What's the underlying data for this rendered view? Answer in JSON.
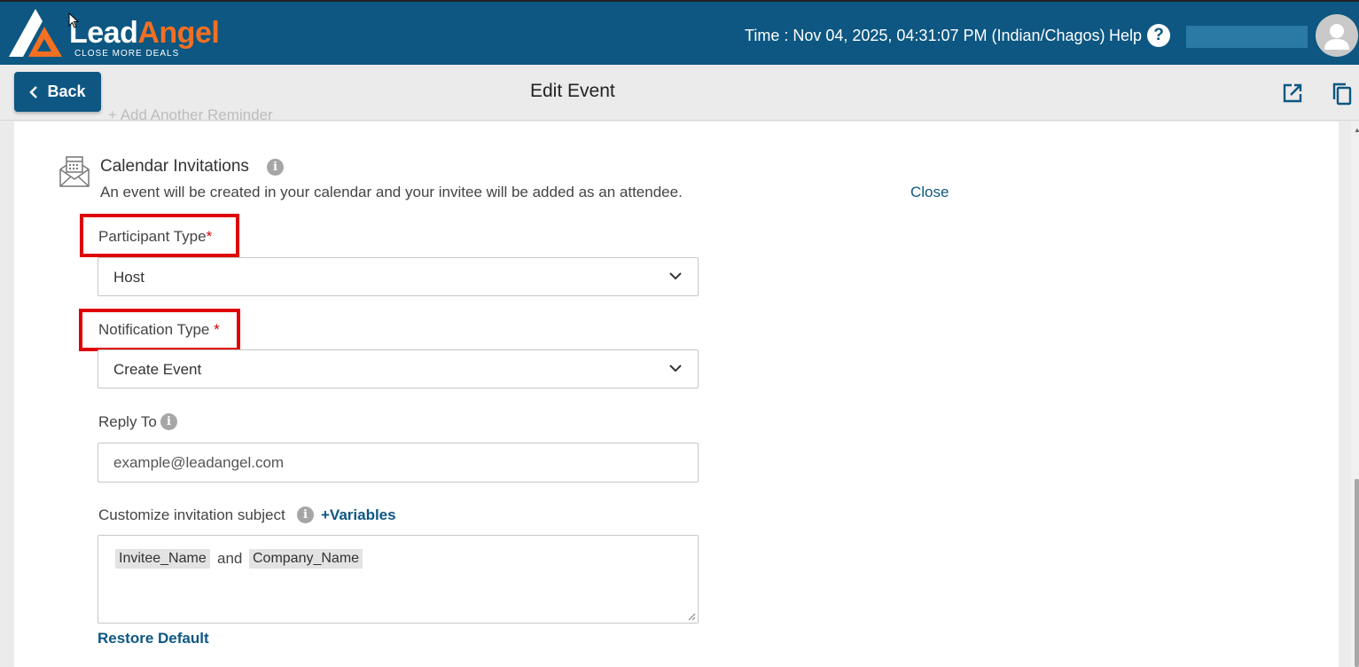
{
  "header": {
    "brand_lead": "Lead",
    "brand_angel": "Angel",
    "brand_tagline": "CLOSE MORE DEALS",
    "time": "Time : Nov 04, 2025, 04:31:07 PM (Indian/Chagos)",
    "help_label": "Help",
    "help_icon_glyph": "?"
  },
  "toolbar": {
    "back_label": "Back",
    "page_title": "Edit Event"
  },
  "section": {
    "cut_off_text": "+ Add Another Reminder",
    "title": "Calendar Invitations",
    "description": "An event will be created in your calendar and your invitee will be added as an attendee.",
    "close_label": "Close",
    "info_glyph": "i"
  },
  "form": {
    "participant_type": {
      "label": "Participant Type",
      "required_mark": "*",
      "value": "Host"
    },
    "notification_type": {
      "label": "Notification Type",
      "required_mark": "*",
      "value": "Create Event"
    },
    "reply_to": {
      "label": "Reply To",
      "placeholder": "example@leadangel.com"
    },
    "invitation_subject": {
      "label": "Customize invitation subject",
      "variables_label": "+Variables",
      "chip_1": "Invitee_Name",
      "joiner": "and",
      "chip_2": "Company_Name"
    },
    "restore_label": "Restore Default"
  },
  "colors": {
    "brand_blue": "#0d5782",
    "brand_orange": "#f36f21",
    "highlight_red": "#e00000"
  }
}
